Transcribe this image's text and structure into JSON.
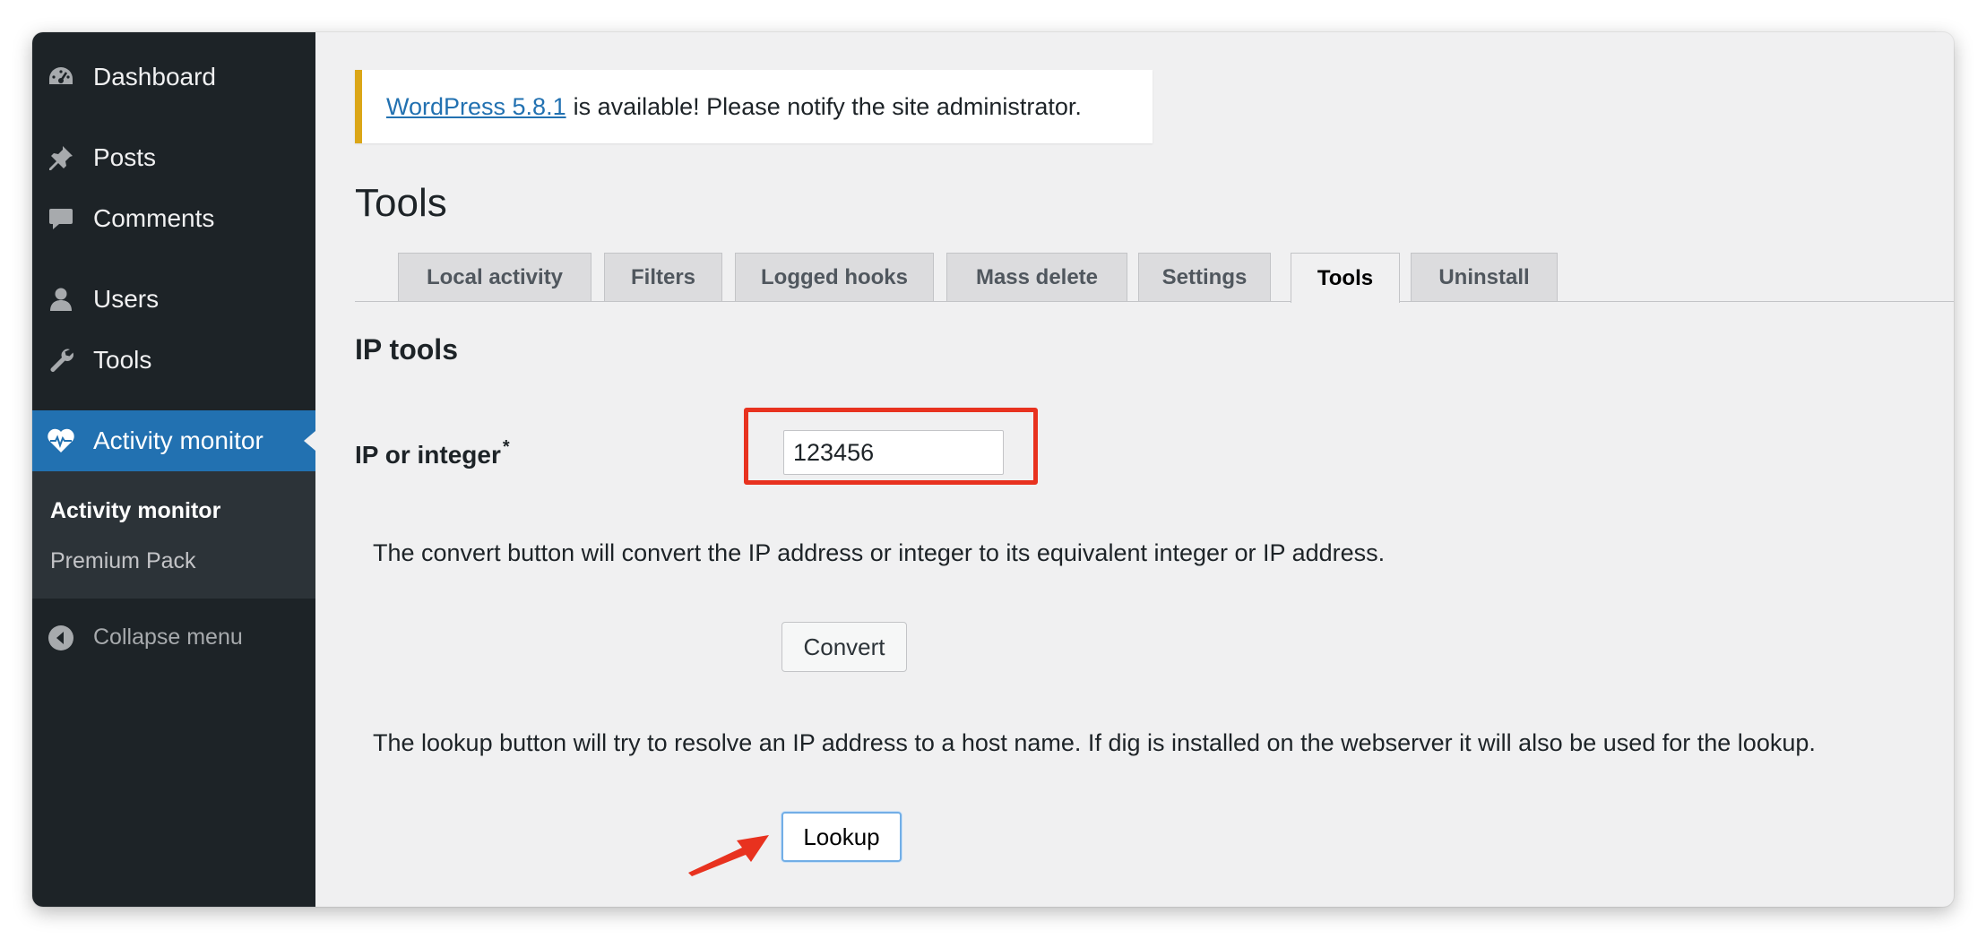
{
  "sidebar": {
    "items": [
      {
        "label": "Dashboard",
        "icon": "dashboard-icon"
      },
      {
        "label": "Posts",
        "icon": "pin-icon"
      },
      {
        "label": "Comments",
        "icon": "comment-icon"
      },
      {
        "label": "Users",
        "icon": "user-icon"
      },
      {
        "label": "Tools",
        "icon": "wrench-icon"
      },
      {
        "label": "Activity monitor",
        "icon": "heart-pulse-icon",
        "active": true
      }
    ],
    "submenu": [
      {
        "label": "Activity monitor",
        "current": true
      },
      {
        "label": "Premium Pack"
      }
    ],
    "collapse_label": "Collapse menu"
  },
  "notice": {
    "link_text": "WordPress 5.8.1",
    "text": "is available! Please notify the site administrator."
  },
  "page": {
    "title": "Tools",
    "tabs": [
      {
        "label": "Local activity"
      },
      {
        "label": "Filters"
      },
      {
        "label": "Logged hooks"
      },
      {
        "label": "Mass delete"
      },
      {
        "label": "Settings"
      },
      {
        "label": "Tools",
        "active": true
      },
      {
        "label": "Uninstall"
      }
    ],
    "section_title": "IP tools",
    "field": {
      "label": "IP or integer",
      "required_mark": "*",
      "value": "123456"
    },
    "convert_desc": "The convert button will convert the IP address or integer to its equivalent integer or IP address.",
    "convert_label": "Convert",
    "lookup_desc": "The lookup button will try to resolve an IP address to a host name. If dig is installed on the webserver it will also be used for the lookup.",
    "lookup_label": "Lookup"
  },
  "colors": {
    "sidebar_bg": "#1d2327",
    "active_bg": "#2271b1",
    "notice_border": "#dba617",
    "highlight": "#e8321f"
  }
}
